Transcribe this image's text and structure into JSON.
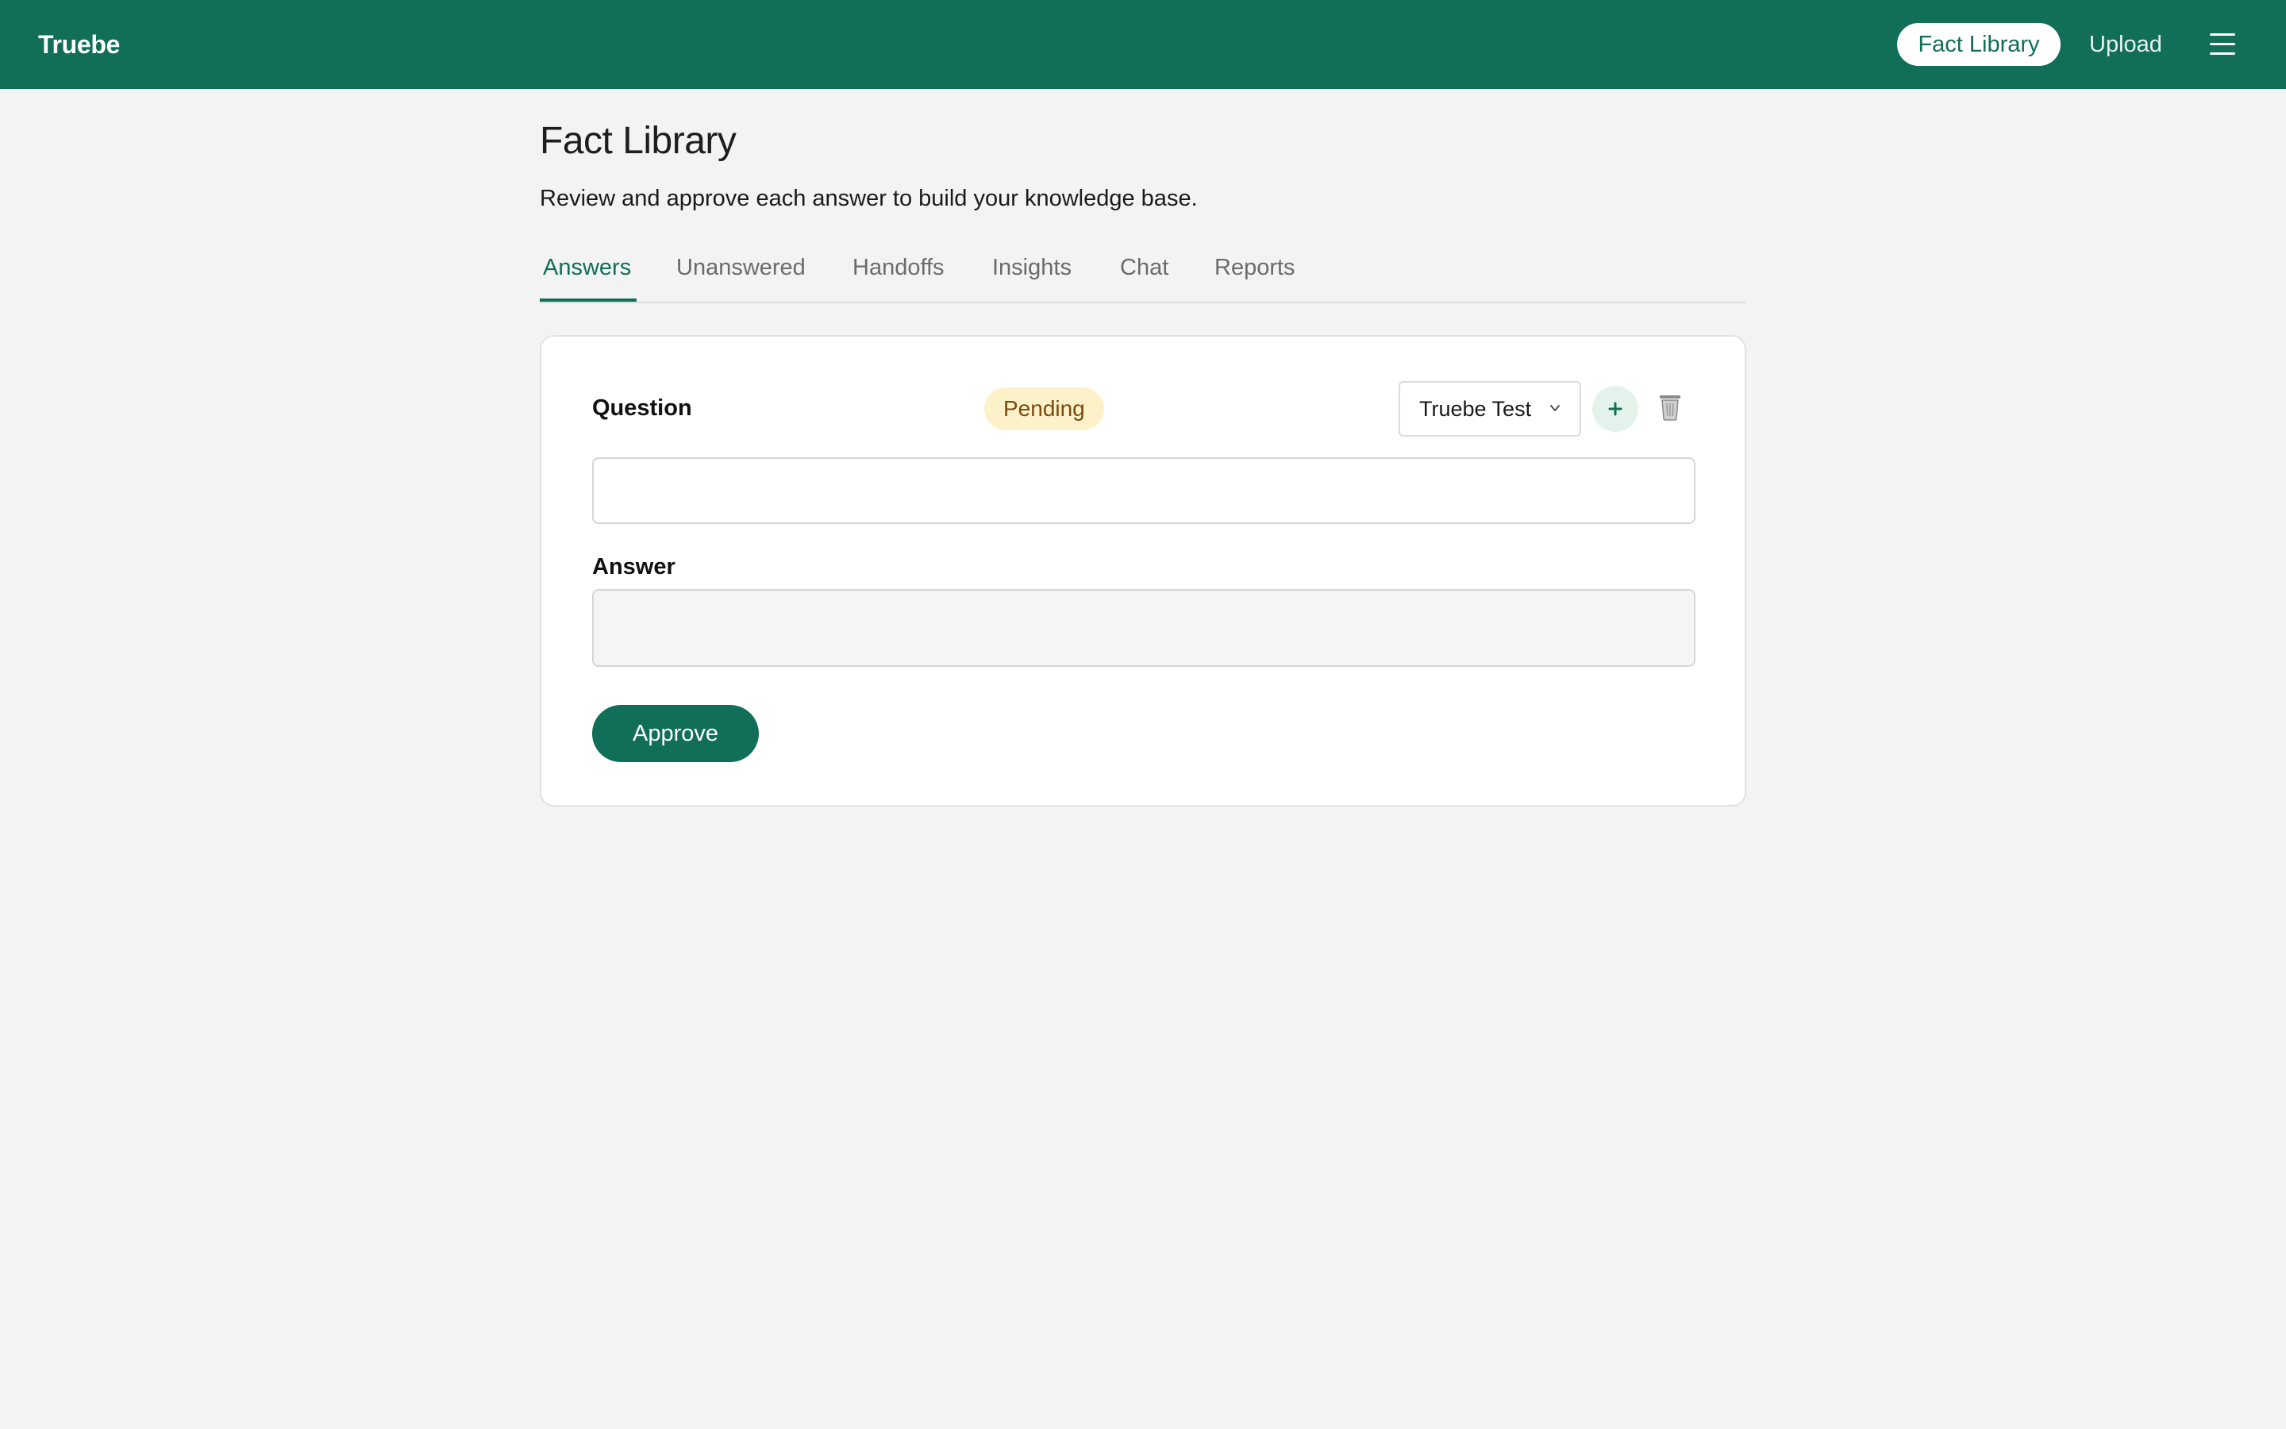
{
  "app": {
    "brand": "Truebe"
  },
  "nav": {
    "active_item": "Fact Library",
    "upload": "Upload",
    "menu_icon": "hamburger-menu-icon"
  },
  "page": {
    "title": "Fact Library",
    "subtitle": "Review and approve each answer to build your knowledge base."
  },
  "tabs": [
    {
      "label": "Answers",
      "active": true
    },
    {
      "label": "Unanswered",
      "active": false
    },
    {
      "label": "Handoffs",
      "active": false
    },
    {
      "label": "Insights",
      "active": false
    },
    {
      "label": "Chat",
      "active": false
    },
    {
      "label": "Reports",
      "active": false
    }
  ],
  "card": {
    "question_label": "Question",
    "status": "Pending",
    "workspace_select": "Truebe Test",
    "add_icon": "plus-icon",
    "delete_icon": "trash-icon",
    "question_value": "",
    "answer_label": "Answer",
    "answer_value": "",
    "approve_label": "Approve"
  },
  "colors": {
    "brand": "#116e58",
    "background": "#f3f3f3",
    "pending_badge_bg": "#fdf1c9",
    "pending_badge_text": "#7a4a0e",
    "add_button_bg": "#e3f3ec"
  }
}
